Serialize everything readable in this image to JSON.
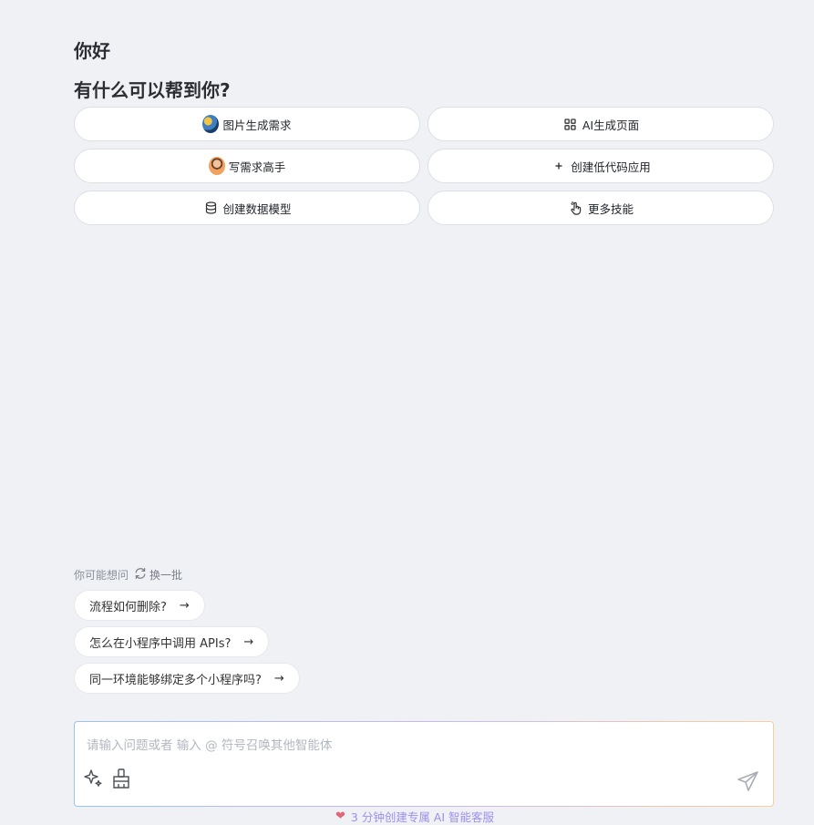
{
  "greeting": {
    "hello": "你好",
    "help": "有什么可以帮到你?"
  },
  "skills": [
    {
      "label": "图片生成需求",
      "icon": "globe-avatar"
    },
    {
      "label": "AI生成页面",
      "icon": "grid-icon"
    },
    {
      "label": "写需求高手",
      "icon": "person-avatar"
    },
    {
      "label": "创建低代码应用",
      "icon": "plus-icon"
    },
    {
      "label": "创建数据模型",
      "icon": "database-icon"
    },
    {
      "label": "更多技能",
      "icon": "pointer-icon"
    }
  ],
  "suggestions": {
    "title": "你可能想问",
    "refresh_label": "换一批",
    "items": [
      "流程如何删除?",
      "怎么在小程序中调用 APIs?",
      "同一环境能够绑定多个小程序吗?"
    ]
  },
  "input": {
    "placeholder": "请输入问题或者 输入 @ 符号召唤其他智能体"
  },
  "footer": {
    "text": "3 分钟创建专属 AI 智能客服"
  },
  "colors": {
    "accent": "#9d8ef0",
    "background": "#f0f1f5"
  }
}
